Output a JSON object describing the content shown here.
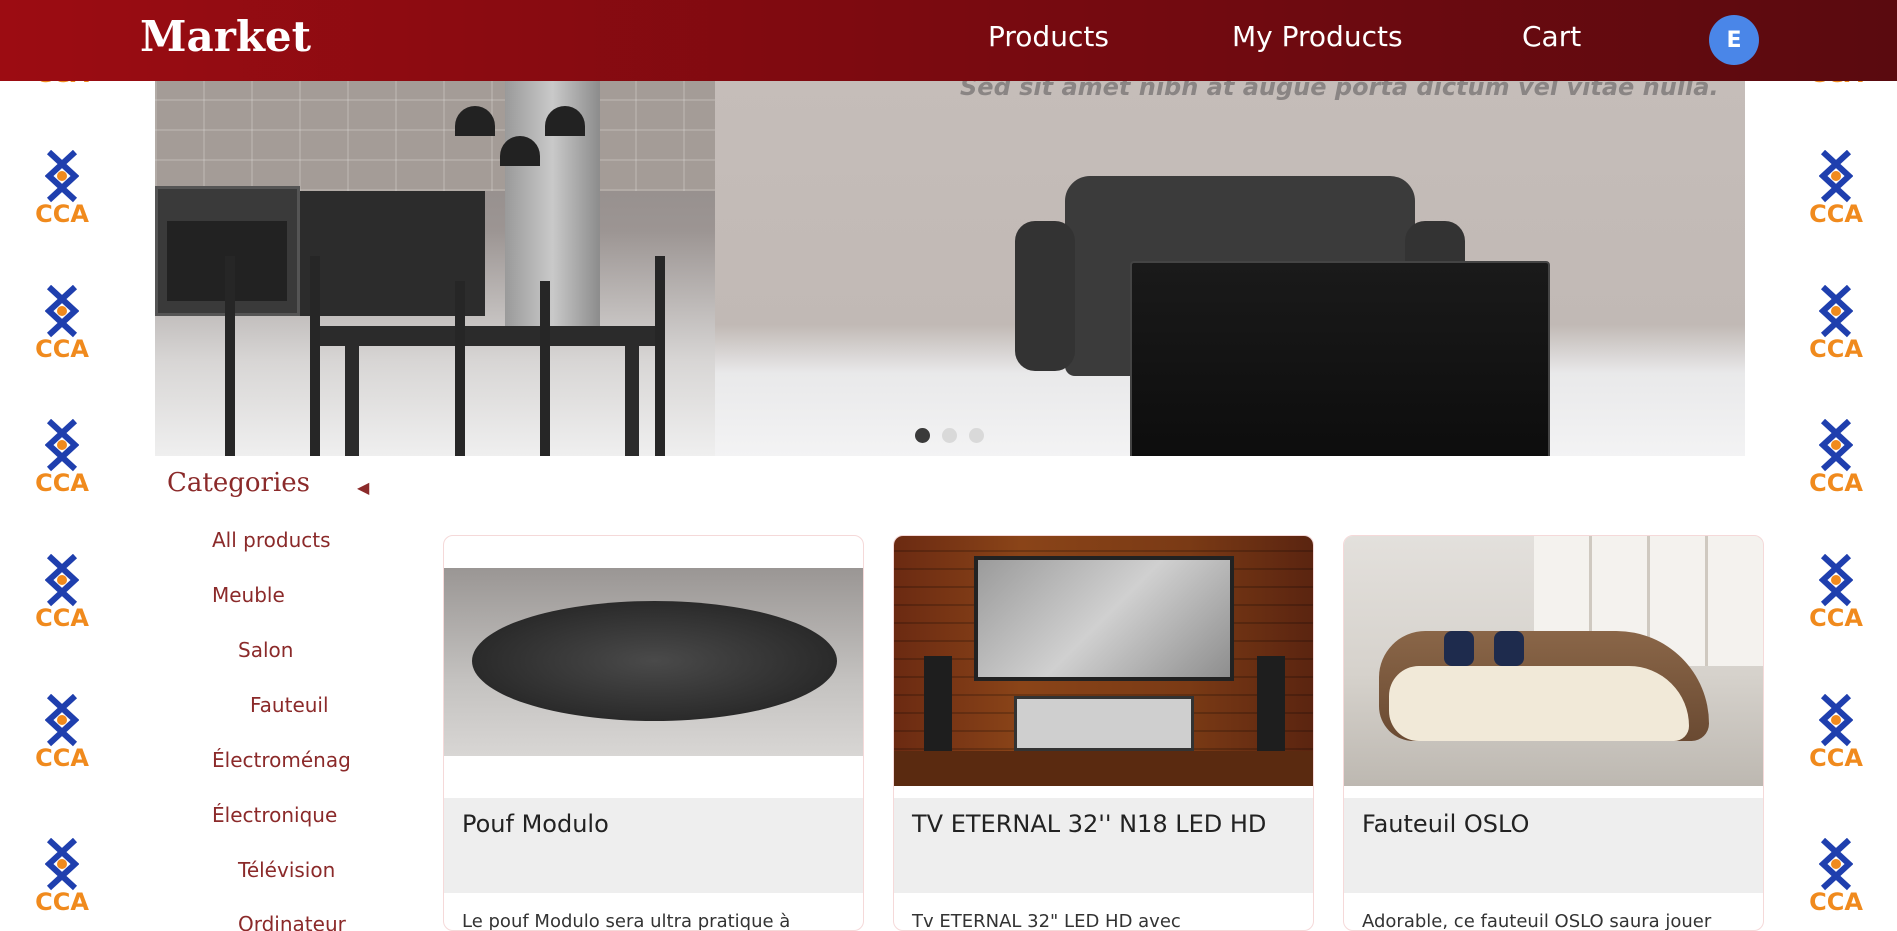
{
  "header": {
    "brand": "Market",
    "nav": [
      {
        "label": "Products"
      },
      {
        "label": "My Products"
      },
      {
        "label": "Cart"
      }
    ],
    "avatar_initial": "E"
  },
  "colors": {
    "header_start": "#9c0c12",
    "header_end": "#5a0a0f",
    "category_text": "#8b2a2a",
    "avatar_bg": "#4a86e8",
    "logo_blue": "#1f3fae",
    "logo_orange": "#f08a1d"
  },
  "side_logo": {
    "text": "CCA",
    "icon": "cca-logo-icon"
  },
  "carousel": {
    "caption": "Sed sit amet nibh at augue porta dictum vel vitae nulla.",
    "slides": 3,
    "active_slide": 1
  },
  "sidebar": {
    "title": "Categories",
    "toggle_icon": "chevron-left-icon",
    "items": [
      {
        "label": "All products"
      },
      {
        "label": "Meuble"
      },
      {
        "label": "Salon"
      },
      {
        "label": "Fauteuil"
      },
      {
        "label": "Électroménag"
      },
      {
        "label": "Électronique"
      },
      {
        "label": "Télévision"
      },
      {
        "label": "Ordinateur"
      }
    ]
  },
  "products": [
    {
      "title": "Pouf Modulo",
      "description": "Le pouf Modulo sera ultra pratique à"
    },
    {
      "title": "TV ETERNAL 32'' N18 LED HD",
      "description": "Tv ETERNAL 32\" LED HD avec"
    },
    {
      "title": "Fauteuil OSLO",
      "description": "Adorable, ce fauteuil OSLO saura jouer"
    }
  ]
}
